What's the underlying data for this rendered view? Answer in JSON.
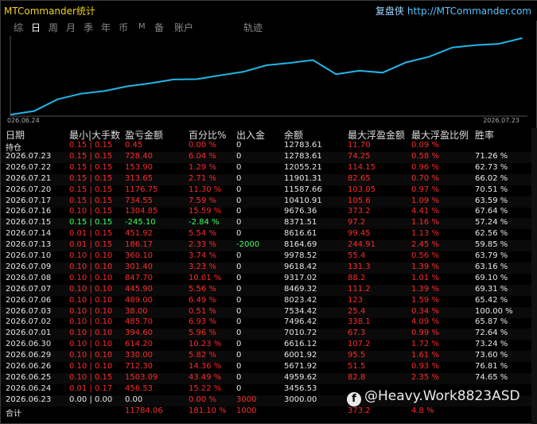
{
  "window": {
    "title": "MTCommander统计"
  },
  "brand": {
    "name": "复盘侠",
    "url": "http://MTCommander.com"
  },
  "tabs": [
    {
      "label": "综",
      "active": false
    },
    {
      "label": "日",
      "active": true
    },
    {
      "label": "周",
      "active": false
    },
    {
      "label": "月",
      "active": false
    },
    {
      "label": "季",
      "active": false
    },
    {
      "label": "年",
      "active": false
    },
    {
      "label": "币",
      "active": false
    },
    {
      "label": "M",
      "active": false
    },
    {
      "label": "备",
      "active": false
    },
    {
      "label": "账户",
      "active": false
    },
    {
      "label": "轨迹",
      "active": false
    }
  ],
  "chart_data": {
    "type": "line",
    "x_start_label": "026.06.24",
    "x_end_label": "2026.07.23",
    "x": [
      "2026.06.23",
      "2026.06.24",
      "2026.06.25",
      "2026.06.26",
      "2026.06.29",
      "2026.06.30",
      "2026.07.01",
      "2026.07.02",
      "2026.07.03",
      "2026.07.06",
      "2026.07.07",
      "2026.07.08",
      "2026.07.09",
      "2026.07.10",
      "2026.07.13",
      "2026.07.14",
      "2026.07.15",
      "2026.07.16",
      "2026.07.17",
      "2026.07.20",
      "2026.07.21",
      "2026.07.22",
      "2026.07.23"
    ],
    "values": [
      3000.0,
      3456.53,
      4959.62,
      5671.92,
      6001.92,
      6616.12,
      7010.72,
      7496.42,
      7534.42,
      8023.42,
      8469.32,
      9317.02,
      9618.42,
      9978.52,
      8164.69,
      8616.61,
      8371.51,
      9676.36,
      10410.91,
      11587.66,
      11901.31,
      12055.21,
      12783.61
    ],
    "color": "#22b6e8",
    "grid": false
  },
  "table": {
    "headers": {
      "date": "日期",
      "lots": "最小|大手数",
      "pnl": "盈亏金额",
      "pct": "百分比%",
      "io": "出入金",
      "balance": "余额",
      "mfe": "最大浮盈金额",
      "mfe_pct": "最大浮盈比例",
      "win": "胜率"
    },
    "rows": [
      {
        "date": "持仓",
        "lots": "0.15 | 0.15",
        "pnl": "0.45",
        "pct": "0.00 %",
        "io": "0",
        "balance": "12783.61",
        "mfe": "11.70",
        "mfe_pct": "0.09 %",
        "win": "",
        "lots_c": "red",
        "pnl_c": "red"
      },
      {
        "date": "2026.07.23",
        "lots": "0.15 | 0.15",
        "pnl": "728.40",
        "pct": "6.04 %",
        "io": "0",
        "balance": "12783.61",
        "mfe": "74.25",
        "mfe_pct": "0.58 %",
        "win": "71.26 %",
        "lots_c": "red",
        "pnl_c": "red"
      },
      {
        "date": "2026.07.22",
        "lots": "0.15 | 0.15",
        "pnl": "153.90",
        "pct": "1.29 %",
        "io": "0",
        "balance": "12055.21",
        "mfe": "114.15",
        "mfe_pct": "0.96 %",
        "win": "62.73 %",
        "lots_c": "red",
        "pnl_c": "red"
      },
      {
        "date": "2026.07.21",
        "lots": "0.15 | 0.15",
        "pnl": "313.65",
        "pct": "2.71 %",
        "io": "0",
        "balance": "11901.31",
        "mfe": "82.65",
        "mfe_pct": "0.70 %",
        "win": "66.02 %",
        "lots_c": "red",
        "pnl_c": "red"
      },
      {
        "date": "2026.07.20",
        "lots": "0.15 | 0.15",
        "pnl": "1176.75",
        "pct": "11.30 %",
        "io": "0",
        "balance": "11587.66",
        "mfe": "103.05",
        "mfe_pct": "0.97 %",
        "win": "70.51 %",
        "lots_c": "red",
        "pnl_c": "red"
      },
      {
        "date": "2026.07.17",
        "lots": "0.15 | 0.15",
        "pnl": "734.55",
        "pct": "7.59 %",
        "io": "0",
        "balance": "10410.91",
        "mfe": "105.6",
        "mfe_pct": "1.09 %",
        "win": "63.59 %",
        "lots_c": "red",
        "pnl_c": "red"
      },
      {
        "date": "2026.07.16",
        "lots": "0.10 | 0.15",
        "pnl": "1304.85",
        "pct": "15.59 %",
        "io": "0",
        "balance": "9676.36",
        "mfe": "373.2",
        "mfe_pct": "4.41 %",
        "win": "67.64 %",
        "lots_c": "red",
        "pnl_c": "red"
      },
      {
        "date": "2026.07.15",
        "lots": "0.15 | 0.15",
        "pnl": "-245.10",
        "pct": "-2.84 %",
        "io": "0",
        "balance": "8371.51",
        "mfe": "97.2",
        "mfe_pct": "1.16 %",
        "win": "57.24 %",
        "lots_c": "green",
        "pnl_c": "green"
      },
      {
        "date": "2026.07.14",
        "lots": "0.01 | 0.15",
        "pnl": "451.92",
        "pct": "5.54 %",
        "io": "0",
        "balance": "8616.61",
        "mfe": "99.45",
        "mfe_pct": "1.13 %",
        "win": "62.56 %",
        "lots_c": "red",
        "pnl_c": "red"
      },
      {
        "date": "2026.07.13",
        "lots": "0.01 | 0.15",
        "pnl": "186.17",
        "pct": "2.33 %",
        "io": "-2000",
        "balance": "8164.69",
        "mfe": "244.91",
        "mfe_pct": "2.45 %",
        "win": "59.85 %",
        "lots_c": "red",
        "pnl_c": "red",
        "io_c": "green"
      },
      {
        "date": "2026.07.10",
        "lots": "0.10 | 0.10",
        "pnl": "360.10",
        "pct": "3.74 %",
        "io": "0",
        "balance": "9978.52",
        "mfe": "55.4",
        "mfe_pct": "0.56 %",
        "win": "63.79 %",
        "lots_c": "red",
        "pnl_c": "red"
      },
      {
        "date": "2026.07.09",
        "lots": "0.10 | 0.10",
        "pnl": "301.40",
        "pct": "3.23 %",
        "io": "0",
        "balance": "9618.42",
        "mfe": "131.3",
        "mfe_pct": "1.39 %",
        "win": "63.16 %",
        "lots_c": "red",
        "pnl_c": "red"
      },
      {
        "date": "2026.07.08",
        "lots": "0.10 | 0.10",
        "pnl": "847.70",
        "pct": "10.01 %",
        "io": "0",
        "balance": "9317.02",
        "mfe": "88.2",
        "mfe_pct": "1.01 %",
        "win": "69.10 %",
        "lots_c": "red",
        "pnl_c": "red"
      },
      {
        "date": "2026.07.07",
        "lots": "0.10 | 0.10",
        "pnl": "445.90",
        "pct": "5.56 %",
        "io": "0",
        "balance": "8469.32",
        "mfe": "111.2",
        "mfe_pct": "1.39 %",
        "win": "69.31 %",
        "lots_c": "red",
        "pnl_c": "red"
      },
      {
        "date": "2026.07.06",
        "lots": "0.10 | 0.10",
        "pnl": "489.00",
        "pct": "6.49 %",
        "io": "0",
        "balance": "8023.42",
        "mfe": "123",
        "mfe_pct": "1.59 %",
        "win": "65.42 %",
        "lots_c": "red",
        "pnl_c": "red"
      },
      {
        "date": "2026.07.03",
        "lots": "0.10 | 0.10",
        "pnl": "38.00",
        "pct": "0.51 %",
        "io": "0",
        "balance": "7534.42",
        "mfe": "25.4",
        "mfe_pct": "0.34 %",
        "win": "100.00 %",
        "lots_c": "red",
        "pnl_c": "red"
      },
      {
        "date": "2026.07.02",
        "lots": "0.10 | 0.10",
        "pnl": "485.70",
        "pct": "6.93 %",
        "io": "0",
        "balance": "7496.42",
        "mfe": "338.1",
        "mfe_pct": "4.09 %",
        "win": "65.87 %",
        "lots_c": "red",
        "pnl_c": "red"
      },
      {
        "date": "2026.07.01",
        "lots": "0.10 | 0.10",
        "pnl": "394.60",
        "pct": "5.96 %",
        "io": "0",
        "balance": "7010.72",
        "mfe": "67.3",
        "mfe_pct": "0.99 %",
        "win": "72.64 %",
        "lots_c": "red",
        "pnl_c": "red"
      },
      {
        "date": "2026.06.30",
        "lots": "0.10 | 0.10",
        "pnl": "614.20",
        "pct": "10.23 %",
        "io": "0",
        "balance": "6616.12",
        "mfe": "107.2",
        "mfe_pct": "1.72 %",
        "win": "73.24 %",
        "lots_c": "red",
        "pnl_c": "red"
      },
      {
        "date": "2026.06.29",
        "lots": "0.10 | 0.10",
        "pnl": "330.00",
        "pct": "5.82 %",
        "io": "0",
        "balance": "6001.92",
        "mfe": "95.5",
        "mfe_pct": "1.61 %",
        "win": "73.60 %",
        "lots_c": "red",
        "pnl_c": "red"
      },
      {
        "date": "2026.06.26",
        "lots": "0.10 | 0.10",
        "pnl": "712.30",
        "pct": "14.36 %",
        "io": "0",
        "balance": "5671.92",
        "mfe": "51.5",
        "mfe_pct": "0.93 %",
        "win": "76.81 %",
        "lots_c": "red",
        "pnl_c": "red"
      },
      {
        "date": "2026.06.25",
        "lots": "0.10 | 0.15",
        "pnl": "1503.09",
        "pct": "43.49 %",
        "io": "0",
        "balance": "4959.62",
        "mfe": "82.8",
        "mfe_pct": "2.35 %",
        "win": "74.65 %",
        "lots_c": "red",
        "pnl_c": "red"
      },
      {
        "date": "2026.06.24",
        "lots": "0.01 | 0.17",
        "pnl": "456.53",
        "pct": "15.22 %",
        "io": "0",
        "balance": "3456.53",
        "mfe": "",
        "mfe_pct": "",
        "win": "",
        "lots_c": "red",
        "pnl_c": "red"
      },
      {
        "date": "2026.06.23",
        "lots": "0.00 | 0.00",
        "pnl": "0.00",
        "pct": "0.00 %",
        "io": "3000",
        "balance": "3000.00",
        "mfe": "",
        "mfe_pct": "",
        "win": "",
        "lots_c": "white",
        "pnl_c": "white",
        "pct_c": "red",
        "io_c": "red"
      },
      {
        "date": "合计",
        "lots": "",
        "pnl": "11784.06",
        "pct": "181.10 %",
        "io": "1000",
        "balance": "",
        "mfe": "373.2",
        "mfe_pct": "4.8 %",
        "win": "",
        "lots_c": "red",
        "pnl_c": "red",
        "io_c": "red"
      }
    ]
  },
  "watermark": {
    "text": "@Heavy.Work8823ASD",
    "icon": "facebook-icon"
  }
}
